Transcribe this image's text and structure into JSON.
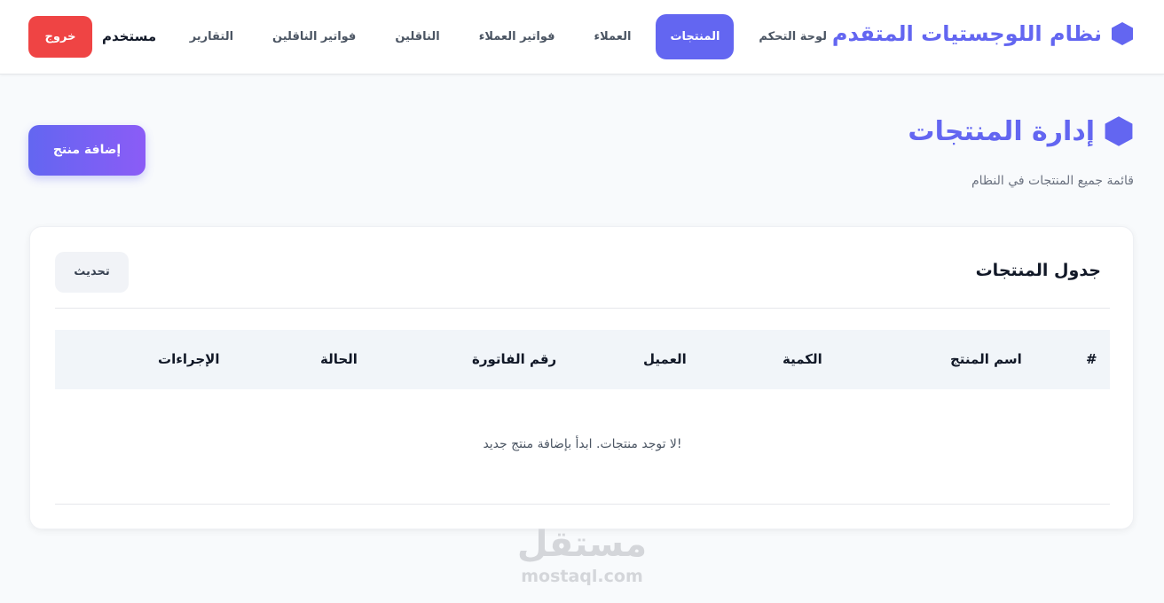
{
  "header": {
    "brand_title": "نظام اللوجستيات المتقدم",
    "brand_icon": "hexagon-icon",
    "nav": [
      {
        "label": "لوحة التحكم",
        "active": false
      },
      {
        "label": "المنتجات",
        "active": true
      },
      {
        "label": "العملاء",
        "active": false
      },
      {
        "label": "فواتير العملاء",
        "active": false
      },
      {
        "label": "الناقلين",
        "active": false
      },
      {
        "label": "فواتير الناقلين",
        "active": false
      },
      {
        "label": "التقارير",
        "active": false
      }
    ],
    "user_name": "مستخدم",
    "logout_label": "خروج"
  },
  "page": {
    "title": "إدارة المنتجات",
    "title_icon": "hexagon-icon",
    "subtitle": "قائمة جميع المنتجات في النظام",
    "add_button_label": "إضافة منتج"
  },
  "table_card": {
    "title": "جدول المنتجات",
    "refresh_label": "تحديث",
    "columns": [
      "#",
      "اسم المنتج",
      "الكمية",
      "العميل",
      "رقم الفاتورة",
      "الحالة",
      "الإجراءات"
    ],
    "rows": [],
    "empty_message": "لا توجد منتجات. ابدأ بإضافة منتج جديد!"
  },
  "watermark": {
    "arabic": "مستقل",
    "latin": "mostaql.com"
  },
  "colors": {
    "accent": "#6366f1",
    "accent_gradient_end": "#8b5cf6",
    "danger": "#ef4444",
    "background": "#f8fafc"
  }
}
